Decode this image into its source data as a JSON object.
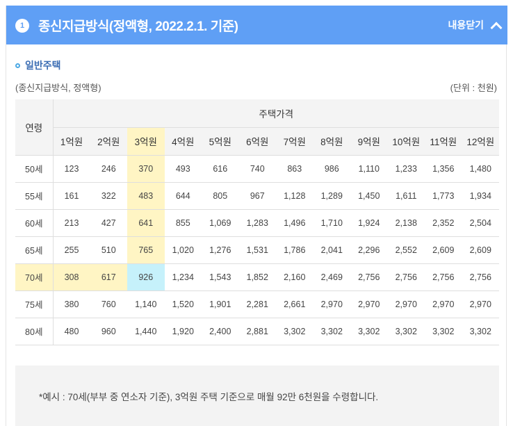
{
  "header": {
    "number": "1",
    "title": "종신지급방식(정액형, 2022.2.1. 기준)",
    "toggle_label": "내용닫기"
  },
  "section": {
    "title": "일반주택",
    "subtitle": "(종신지급방식, 정액형)",
    "unit": "(단위 : 천원)"
  },
  "table": {
    "age_header": "연령",
    "group_header": "주택가격",
    "columns": [
      "1억원",
      "2억원",
      "3억원",
      "4억원",
      "5억원",
      "6억원",
      "7억원",
      "8억원",
      "9억원",
      "10억원",
      "11억원",
      "12억원"
    ],
    "rows": [
      {
        "age": "50세",
        "values": [
          "123",
          "246",
          "370",
          "493",
          "616",
          "740",
          "863",
          "986",
          "1,110",
          "1,233",
          "1,356",
          "1,480"
        ]
      },
      {
        "age": "55세",
        "values": [
          "161",
          "322",
          "483",
          "644",
          "805",
          "967",
          "1,128",
          "1,289",
          "1,450",
          "1,611",
          "1,773",
          "1,934"
        ]
      },
      {
        "age": "60세",
        "values": [
          "213",
          "427",
          "641",
          "855",
          "1,069",
          "1,283",
          "1,496",
          "1,710",
          "1,924",
          "2,138",
          "2,352",
          "2,504"
        ]
      },
      {
        "age": "65세",
        "values": [
          "255",
          "510",
          "765",
          "1,020",
          "1,276",
          "1,531",
          "1,786",
          "2,041",
          "2,296",
          "2,552",
          "2,609",
          "2,609"
        ]
      },
      {
        "age": "70세",
        "values": [
          "308",
          "617",
          "926",
          "1,234",
          "1,543",
          "1,852",
          "2,160",
          "2,469",
          "2,756",
          "2,756",
          "2,756",
          "2,756"
        ]
      },
      {
        "age": "75세",
        "values": [
          "380",
          "760",
          "1,140",
          "1,520",
          "1,901",
          "2,281",
          "2,661",
          "2,970",
          "2,970",
          "2,970",
          "2,970",
          "2,970"
        ]
      },
      {
        "age": "80세",
        "values": [
          "480",
          "960",
          "1,440",
          "1,920",
          "2,400",
          "2,881",
          "3,302",
          "3,302",
          "3,302",
          "3,302",
          "3,302",
          "3,302"
        ]
      }
    ],
    "highlight": {
      "column_index": 2,
      "row_index": 4,
      "colors": {
        "yellow": "#fff5c4",
        "cyan": "#c6f1fb"
      }
    }
  },
  "example": {
    "text": "*예시 : 70세(부부 중 연소자 기준), 3억원 주택 기준으로 매월 92만 6천원을 수령합니다."
  },
  "colors": {
    "header_bg": "#5f9ff5",
    "section_title": "#3b6db3",
    "bullet": "#4aa8e4"
  },
  "icons": {
    "badge": "number-badge",
    "toggle": "chevron-up-icon",
    "bullet": "circle-bullet-icon"
  }
}
